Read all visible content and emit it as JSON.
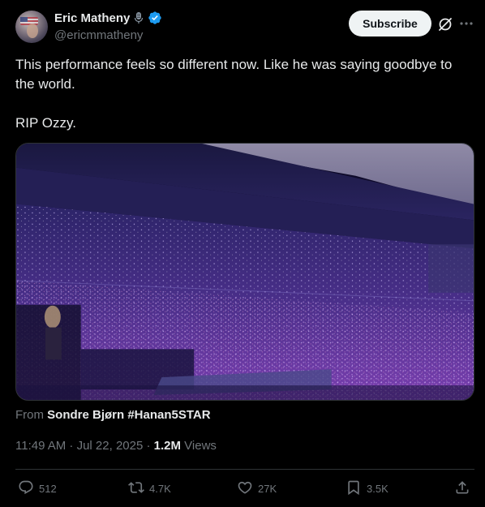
{
  "author": {
    "name": "Eric Matheny",
    "handle": "@ericmmatheny"
  },
  "header": {
    "subscribe_label": "Subscribe"
  },
  "tweet": {
    "text": "This performance feels so different now. Like he was saying goodbye to the world.\n\nRIP Ozzy."
  },
  "media": {
    "from_prefix": "From",
    "from_source": "Sondre Bjørn #Hanan5STAR"
  },
  "meta": {
    "timestamp": "11:49 AM · Jul 22, 2025 · ",
    "views_count": "1.2M",
    "views_label": " Views"
  },
  "actions": {
    "replies": "512",
    "reposts": "4.7K",
    "likes": "27K",
    "bookmarks": "3.5K"
  },
  "colors": {
    "background": "#000000",
    "text": "#e7e9ea",
    "muted": "#71767b",
    "verified": "#1d9bf0",
    "border": "#2f3336"
  },
  "icons": [
    "microphone-icon",
    "verified-badge-icon",
    "grok-icon",
    "more-icon",
    "reply-icon",
    "repost-icon",
    "like-icon",
    "bookmark-icon",
    "share-icon"
  ]
}
